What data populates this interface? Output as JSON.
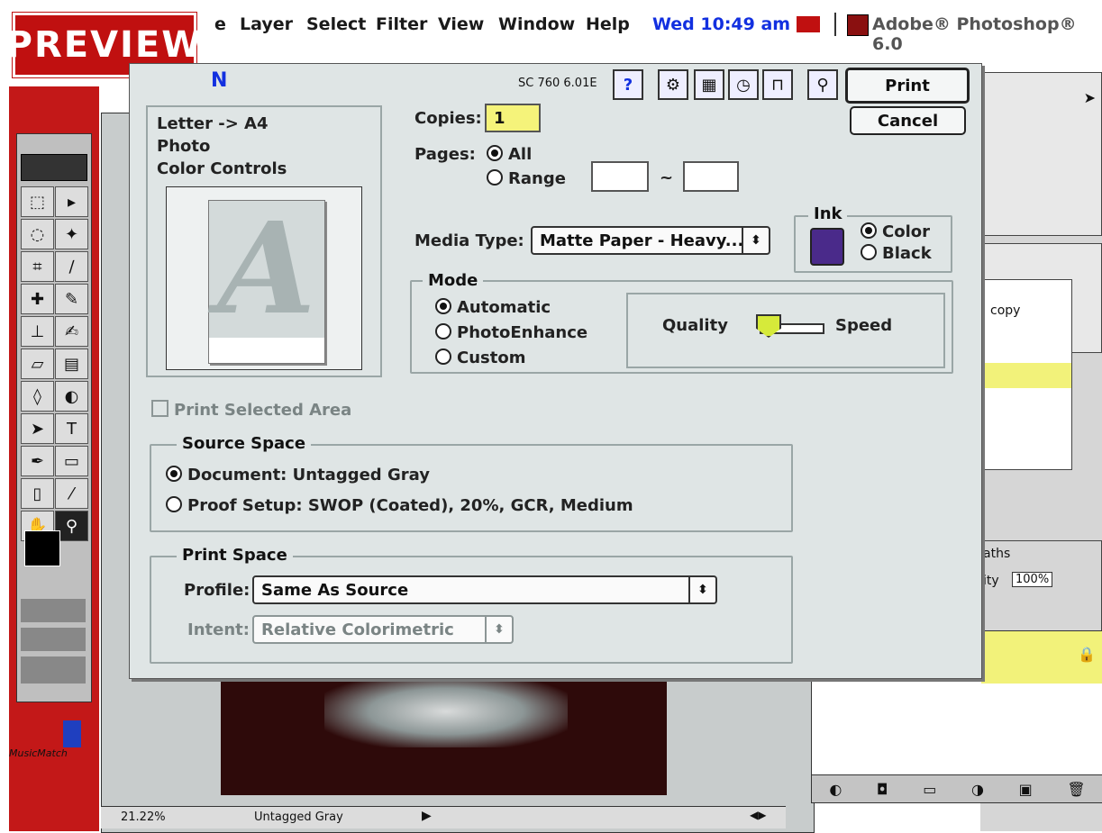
{
  "menubar": {
    "items": [
      "e",
      "Layer",
      "Select",
      "Filter",
      "View",
      "Window",
      "Help"
    ],
    "clock": "Wed 10:49 am",
    "app_title": "Adobe® Photoshop® 6.0"
  },
  "preview_badge": "PREVIEW",
  "dialog": {
    "title_fragment": "N",
    "model": "SC 760 6.01E",
    "print_button": "Print",
    "cancel_button": "Cancel",
    "help_icon": "?",
    "summary": [
      "Letter -> A4",
      "Photo",
      "Color Controls"
    ],
    "preview_letter": "A",
    "copies_label": "Copies:",
    "copies_value": "1",
    "pages_label": "Pages:",
    "pages_all": "All",
    "pages_range": "Range",
    "range_sep": "~",
    "media_label": "Media Type:",
    "media_value": "Matte Paper - Heavy...",
    "ink_title": "Ink",
    "ink_color": "Color",
    "ink_black": "Black",
    "mode_title": "Mode",
    "mode_automatic": "Automatic",
    "mode_photoenhance": "PhotoEnhance",
    "mode_custom": "Custom",
    "quality_label": "Quality",
    "speed_label": "Speed",
    "print_selected_area": "Print Selected Area",
    "source_title": "Source Space",
    "source_document": "Document: Untagged Gray",
    "source_proof": "Proof Setup: SWOP (Coated), 20%, GCR, Medium",
    "print_space_title": "Print Space",
    "profile_label": "Profile:",
    "profile_value": "Same As Source",
    "intent_label": "Intent:",
    "intent_value": "Relative Colorimetric"
  },
  "statusbar": {
    "zoom": "21.22%",
    "info": "Untagged Gray"
  },
  "right_panels": {
    "layer_copy": "copy",
    "paths_tab": "aths",
    "opacity_label": "ity",
    "opacity_value": "100%"
  },
  "dock_label": "MusicMatch",
  "colors": {
    "accent_red": "#c31818",
    "dialog_bg": "#dfe5e5",
    "copies_highlight": "#f5f37a",
    "clock_blue": "#1230e0"
  }
}
